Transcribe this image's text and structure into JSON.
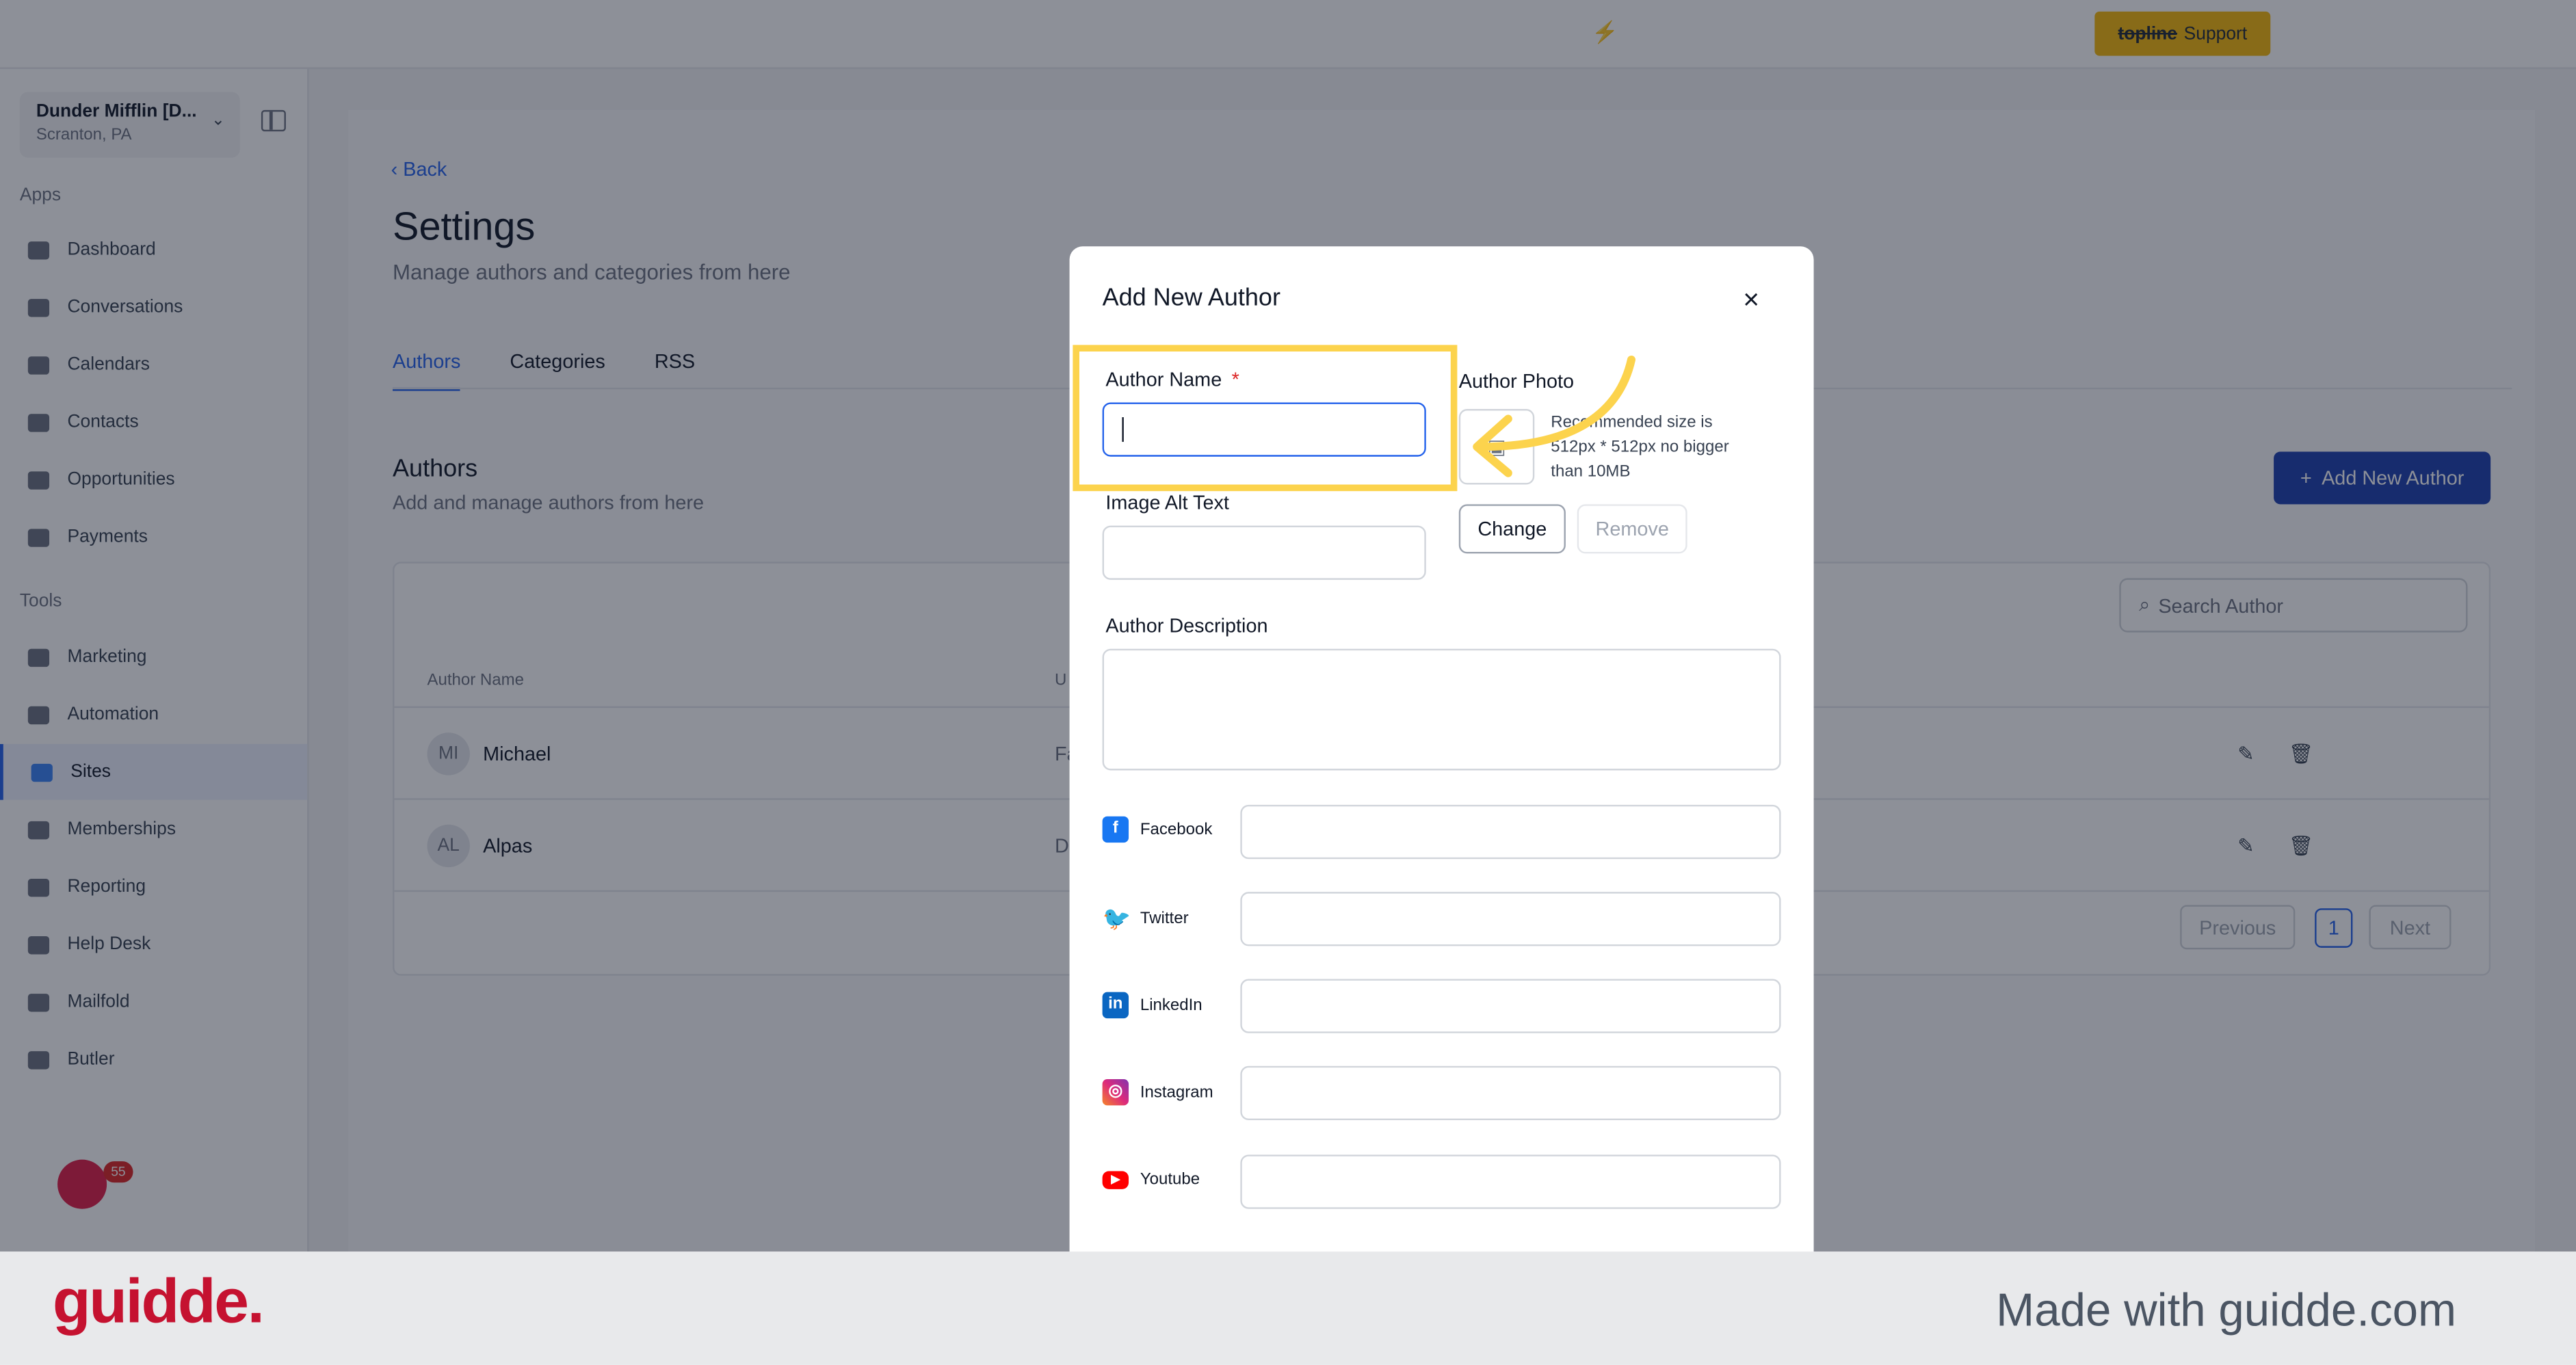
{
  "topbar": {
    "support_brand": "topline",
    "support_label": "Support",
    "bolt_icon": "⚡"
  },
  "sidebar": {
    "account_name": "Dunder Mifflin [D...",
    "account_location": "Scranton, PA",
    "apps_label": "Apps",
    "tools_label": "Tools",
    "apps": [
      {
        "label": "Dashboard",
        "icon": "dashboard-icon"
      },
      {
        "label": "Conversations",
        "icon": "chat-icon"
      },
      {
        "label": "Calendars",
        "icon": "calendar-icon"
      },
      {
        "label": "Contacts",
        "icon": "user-icon"
      },
      {
        "label": "Opportunities",
        "icon": "target-icon"
      },
      {
        "label": "Payments",
        "icon": "card-icon"
      }
    ],
    "tools": [
      {
        "label": "Marketing",
        "icon": "megaphone-icon"
      },
      {
        "label": "Automation",
        "icon": "gears-icon"
      },
      {
        "label": "Sites",
        "icon": "globe-icon",
        "active": true
      },
      {
        "label": "Memberships",
        "icon": "people-icon"
      },
      {
        "label": "Reporting",
        "icon": "pie-icon"
      },
      {
        "label": "Help Desk",
        "icon": "help-icon"
      },
      {
        "label": "Mailfold",
        "icon": "mail-icon"
      },
      {
        "label": "Butler",
        "icon": "bell-icon"
      }
    ],
    "notification_count": "55"
  },
  "main": {
    "back_label": "Back",
    "title": "Settings",
    "subtitle": "Manage authors and categories from here",
    "tabs": [
      {
        "label": "Authors",
        "active": true
      },
      {
        "label": "Categories"
      },
      {
        "label": "RSS"
      }
    ],
    "section_title": "Authors",
    "section_subtitle": "Add and manage authors from here",
    "add_button": "Add New Author",
    "search_placeholder": "Search Author",
    "col_author_name": "Author Name",
    "col_second": "U",
    "rows": [
      {
        "initials": "MI",
        "name": "Michael",
        "url": "Fa"
      },
      {
        "initials": "AL",
        "name": "Alpas",
        "url": "D"
      }
    ],
    "pager": {
      "previous": "Previous",
      "current": "1",
      "next": "Next"
    }
  },
  "modal": {
    "title": "Add New Author",
    "close_icon": "×",
    "author_name_label": "Author Name",
    "required_mark": "*",
    "author_photo_label": "Author Photo",
    "photo_hint": "Recommended size is 512px * 512px no bigger than 10MB",
    "change_label": "Change",
    "remove_label": "Remove",
    "alt_text_label": "Image Alt Text",
    "description_label": "Author Description",
    "socials": [
      {
        "label": "Facebook",
        "icon": "facebook-icon",
        "glyph": "f"
      },
      {
        "label": "Twitter",
        "icon": "twitter-icon",
        "glyph": "🐦"
      },
      {
        "label": "LinkedIn",
        "icon": "linkedin-icon",
        "glyph": "in"
      },
      {
        "label": "Instagram",
        "icon": "instagram-icon",
        "glyph": "◎"
      },
      {
        "label": "Youtube",
        "icon": "youtube-icon",
        "glyph": "▶"
      }
    ]
  },
  "footer": {
    "logo": "guidde.",
    "tagline": "Made with guidde.com"
  },
  "colors": {
    "accent": "#2563eb",
    "highlight": "#fcd34d",
    "brand": "#c51230"
  }
}
